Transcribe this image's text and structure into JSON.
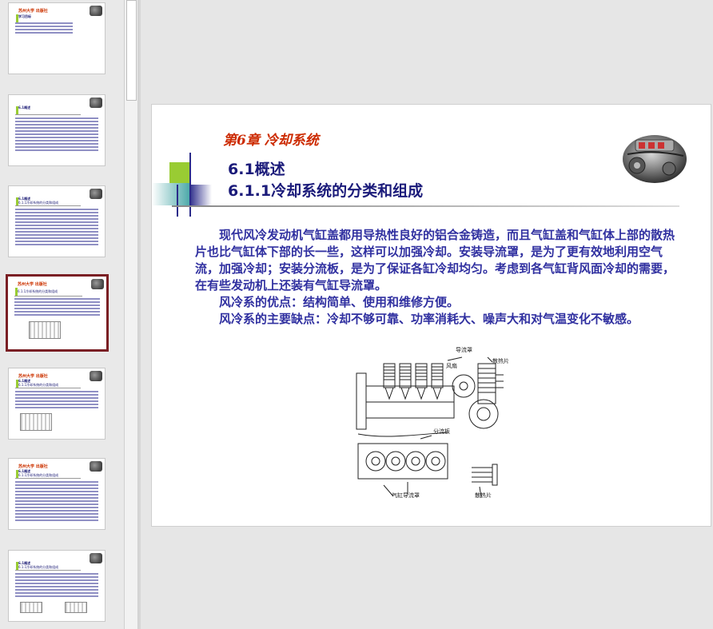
{
  "thumbnails": {
    "numbers": [],
    "items": [
      {
        "logo": "苏州大学 出版社",
        "title": "学习目标",
        "subtitle": ""
      },
      {
        "logo": "",
        "title": "6.1概述",
        "subtitle": ""
      },
      {
        "logo": "",
        "title": "6.1概述",
        "subtitle": "6.1.1冷却系统的分类和组成"
      },
      {
        "logo": "苏州大学 出版社",
        "title": "",
        "subtitle": "6.1.1冷却系统的分类和组成"
      },
      {
        "logo": "苏州大学 出版社",
        "title": "6.1概述",
        "subtitle": "6.1.1冷却系统的分类和组成"
      },
      {
        "logo": "苏州大学 出版社",
        "title": "6.1概述",
        "subtitle": "6.1.1冷却系统的分类和组成"
      },
      {
        "logo": "",
        "title": "6.1概述",
        "subtitle": "6.1.1冷却系统的分类和组成"
      }
    ]
  },
  "slide": {
    "chapter": "第6章  冷却系统",
    "section": "6.1概述",
    "subsection": "6.1.1冷却系统的分类和组成",
    "paragraphs": [
      "现代风冷发动机气缸盖都用导热性良好的铝合金铸造，而且气缸盖和气缸体上部的散热片也比气缸体下部的长一些，这样可以加强冷却。安装导流罩，是为了更有效地利用空气流，加强冷却；安装分流板，是为了保证各缸冷却均匀。考虑到各气缸背风面冷却的需要，在有些发动机上还装有气缸导流罩。",
      "风冷系的优点：结构简单、使用和维修方便。",
      "风冷系的主要缺点：冷却不够可靠、功率消耗大、噪声大和对气温变化不敏感。"
    ],
    "figure_labels": {
      "deflector": "导流罩",
      "fan": "风扇",
      "fins_top": "散热片",
      "splitter": "分流板",
      "cylinder_deflector": "气缸导流罩",
      "fins_bottom": "散热片"
    }
  },
  "colors": {
    "chapter": "#cc2a00",
    "title": "#1b1b7a",
    "body": "#3030a0",
    "selected_border": "#7a1f24"
  }
}
